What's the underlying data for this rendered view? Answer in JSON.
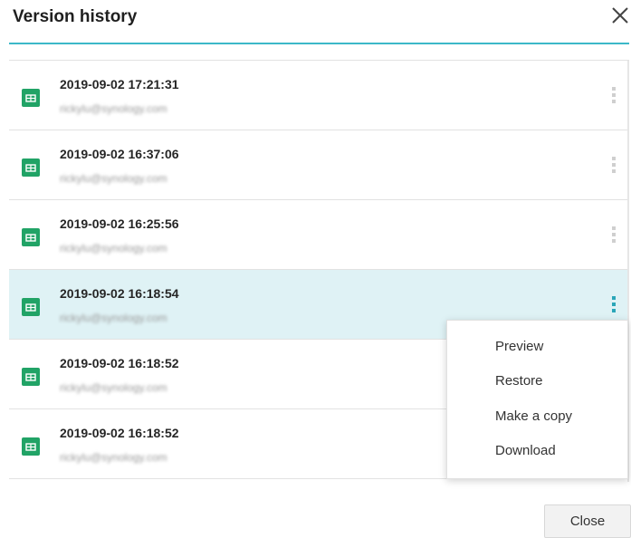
{
  "dialog": {
    "title": "Version history",
    "close_label": "Close"
  },
  "versions": [
    {
      "timestamp": "2019-09-02 17:21:31",
      "user": "rickylu@synology.com"
    },
    {
      "timestamp": "2019-09-02 16:37:06",
      "user": "rickylu@synology.com"
    },
    {
      "timestamp": "2019-09-02 16:25:56",
      "user": "rickylu@synology.com"
    },
    {
      "timestamp": "2019-09-02 16:18:54",
      "user": "rickylu@synology.com",
      "selected": true
    },
    {
      "timestamp": "2019-09-02 16:18:52",
      "user": "rickylu@synology.com"
    },
    {
      "timestamp": "2019-09-02 16:18:52",
      "user": "rickylu@synology.com"
    }
  ],
  "context_menu": {
    "items": [
      "Preview",
      "Restore",
      "Make a copy",
      "Download"
    ]
  },
  "colors": {
    "accent": "#3cb8c8",
    "selected_row": "#dff2f5",
    "file_icon": "#21a366"
  },
  "icons": {
    "file": "spreadsheet-icon",
    "close": "close-icon",
    "more": "more-vertical-icon"
  }
}
